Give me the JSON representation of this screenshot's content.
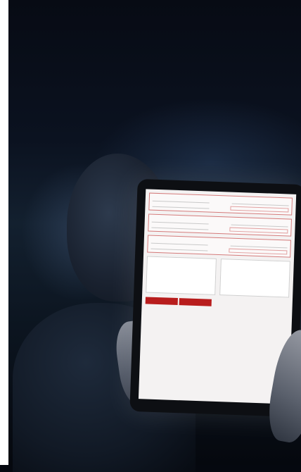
{
  "scene": {
    "description_tag": "",
    "form": {
      "sections": [
        {
          "title": "",
          "field_a": "",
          "field_b": ""
        },
        {
          "title": "",
          "field_a": "",
          "field_b": ""
        },
        {
          "title": "",
          "field_a": "",
          "field_b": ""
        }
      ],
      "buttons": [
        {
          "label": ""
        },
        {
          "label": ""
        }
      ]
    }
  },
  "colors": {
    "accent": "#b81d1d",
    "section_border": "#d47b7b",
    "background": "#0b1220"
  }
}
